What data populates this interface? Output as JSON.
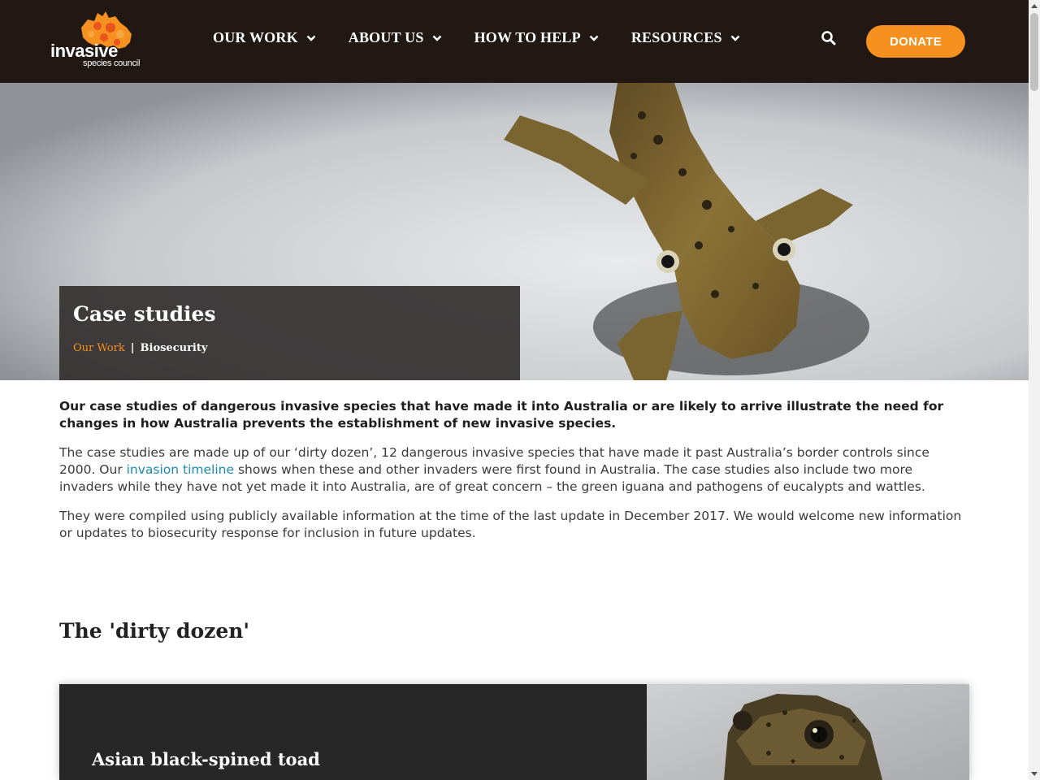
{
  "header": {
    "logo": {
      "word": "invasive",
      "sub": "species council"
    },
    "nav": [
      {
        "label": "OUR WORK"
      },
      {
        "label": "ABOUT US"
      },
      {
        "label": "HOW TO HELP"
      },
      {
        "label": "RESOURCES"
      }
    ],
    "donate_label": "DONATE",
    "colors": {
      "background": "#211813",
      "accent": "#f6901e"
    }
  },
  "hero": {
    "title": "Case studies",
    "breadcrumb": {
      "link": "Our Work",
      "separator": "|",
      "current": "Biosecurity"
    }
  },
  "intro": {
    "lead": "Our case studies of dangerous invasive species that have made it into Australia or are likely to arrive illustrate the need for changes in how Australia prevents the establishment of new invasive species.",
    "p1_before": "The case studies are made up of our ‘dirty dozen’, 12 dangerous invasive species that have made it past Australia’s border controls since 2000. Our ",
    "p1_link": "invasion timeline",
    "p1_after": " shows when these and other invaders were first found in Australia. The case studies also include two more invaders while they have not yet made it into Australia, are of great concern – the green iguana and pathogens of eucalypts and wattles.",
    "p2": "They were compiled using publicly available information at the time of the last update in December 2017. We would welcome new information or updates to biosecurity response for inclusion in future updates."
  },
  "section": {
    "title": "The 'dirty dozen'"
  },
  "cards": [
    {
      "title": "Asian black-spined toad"
    }
  ]
}
